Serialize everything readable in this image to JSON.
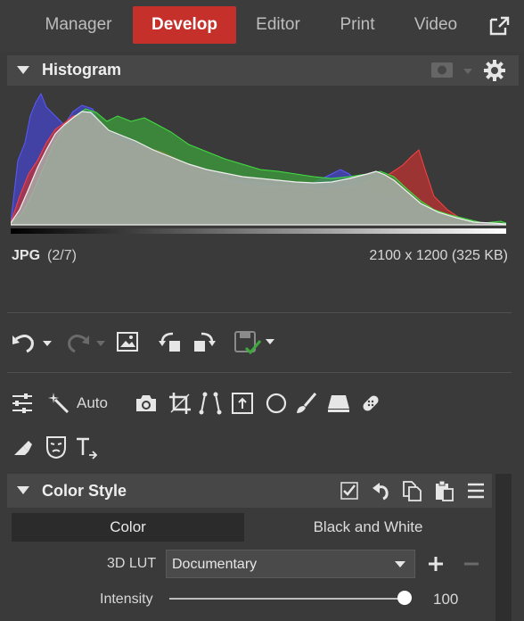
{
  "nav": {
    "tabs": [
      {
        "label": "Manager",
        "active": false
      },
      {
        "label": "Develop",
        "active": true
      },
      {
        "label": "Editor",
        "active": false
      },
      {
        "label": "Print",
        "active": false
      },
      {
        "label": "Video",
        "active": false
      }
    ],
    "external_icon": "external-window-icon"
  },
  "histogram": {
    "title": "Histogram",
    "file_type": "JPG",
    "position": "(2/7)",
    "dimensions": "2100 x 1200 (325 KB)"
  },
  "toolbar": {
    "auto_label": "Auto"
  },
  "color_style": {
    "title": "Color Style",
    "mode_color": "Color",
    "mode_bw": "Black and White",
    "lut_label": "3D LUT",
    "lut_value": "Documentary",
    "intensity_label": "Intensity",
    "intensity_value": "100"
  },
  "colors": {
    "accent": "#c5302b",
    "panel_bg": "#3a3a3a",
    "header_bg": "#474747"
  }
}
